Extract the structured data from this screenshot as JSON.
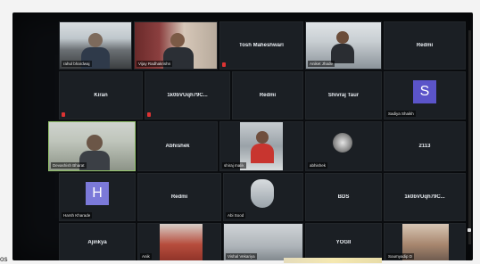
{
  "window": {
    "corner_text": "os"
  },
  "tiles": {
    "r1c1": {
      "label": "rahul bhardwaj"
    },
    "r1c2": {
      "label": "Vijay Radhakrishn"
    },
    "r1c3": {
      "name": "Tosh Maheshwari"
    },
    "r1c4": {
      "label": "Aniket Jhade"
    },
    "r1c5": {
      "name": "Redmi"
    },
    "r2c1": {
      "name": "Kiran"
    },
    "r2c2": {
      "name": "1k0bVUqh79C..."
    },
    "r2c3": {
      "name": "Redmi"
    },
    "r2c4": {
      "name": "Shivraj Taur"
    },
    "r2c5": {
      "avatar_letter": "S",
      "label": "Sadiya Shaikh",
      "avatar_color": "#5b54c9"
    },
    "r3c1": {
      "label": "Devashish Bharat"
    },
    "r3c2": {
      "name": "Abhishek"
    },
    "r3c3": {
      "label": "shiraj malik"
    },
    "r3c4": {
      "label": "abhishek"
    },
    "r3c5": {
      "name": "2113"
    },
    "r4c1": {
      "avatar_letter": "H",
      "label": "Harsh Kharade",
      "avatar_color": "#7b79d9"
    },
    "r4c2": {
      "name": "Redmi"
    },
    "r4c3": {
      "label": "Abi Sood"
    },
    "r4c4": {
      "name": "BDS"
    },
    "r4c5": {
      "name": "1k0bVUqh79C..."
    },
    "r5c1": {
      "name": "Ajinkya"
    },
    "r5c2": {
      "label": "Anik"
    },
    "r5c3": {
      "label": "Vishal Vekariya"
    },
    "r5c4": {
      "name": "YOGII"
    },
    "r5c5": {
      "label": "Soumyadip D"
    }
  },
  "colors": {
    "active_border": "#93c46b",
    "tile_bg": "#1b1f24",
    "mic_muted": "#dd3333"
  },
  "icons": {
    "mic": "mic-muted-icon"
  }
}
